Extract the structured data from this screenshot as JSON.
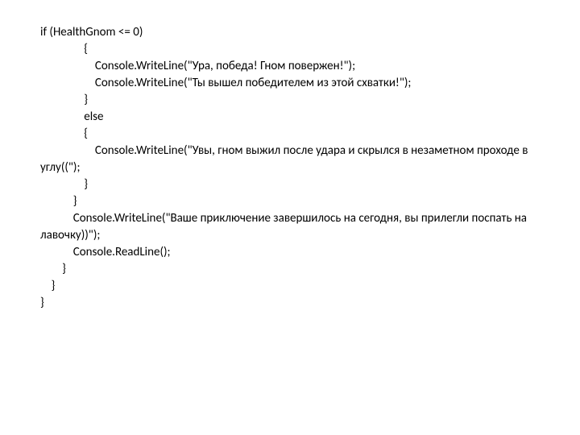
{
  "code": {
    "lines": [
      "if (HealthGnom <= 0)",
      "                {",
      "                    Console.WriteLine(\"Ура, победа! Гном повержен!\");",
      "                    Console.WriteLine(\"Ты вышел победителем из этой схватки!\");",
      "                }",
      "                else",
      "                {",
      "                    Console.WriteLine(\"Увы, гном выжил после удара и скрылся в незаметном проходе в углу((\");",
      "                }",
      "            }",
      "",
      "            Console.WriteLine(\"Ваше приключение завершилось на сегодня, вы прилегли поспать на лавочку))\");",
      "            Console.ReadLine();",
      "        }",
      "    }",
      "}"
    ]
  }
}
